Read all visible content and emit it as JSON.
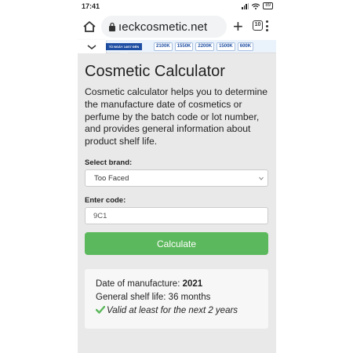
{
  "status_bar": {
    "time": "17:41",
    "battery": "89"
  },
  "browser": {
    "url": "ıeckcosmetic.net",
    "tab_count": "10"
  },
  "ad": {
    "logo_text": "TỦ NGÀY 14/07 ĐẾN 18/07",
    "prices": [
      "2100K",
      "1550K",
      "2200K",
      "1500K",
      "600K"
    ]
  },
  "page": {
    "title": "Cosmetic Calculator",
    "intro": "Cosmetic calculator helps you to determine the manufacture date of cosmetics or perfume by the batch code or lot number, and provides general information about product shelf life.",
    "brand_label": "Select brand:",
    "brand_value": "Too Faced",
    "code_label": "Enter code:",
    "code_value": "9C1",
    "calculate_label": "Calculate"
  },
  "result": {
    "manufacture_label": "Date of manufacture:",
    "manufacture_value": "2021",
    "shelf_life": "General shelf life: 36 months",
    "validity": "Valid at least for the next 2 years"
  },
  "colors": {
    "accent_green": "#5cb85c",
    "check_green": "#5cb85c",
    "content_bg": "#e9e9e9"
  }
}
